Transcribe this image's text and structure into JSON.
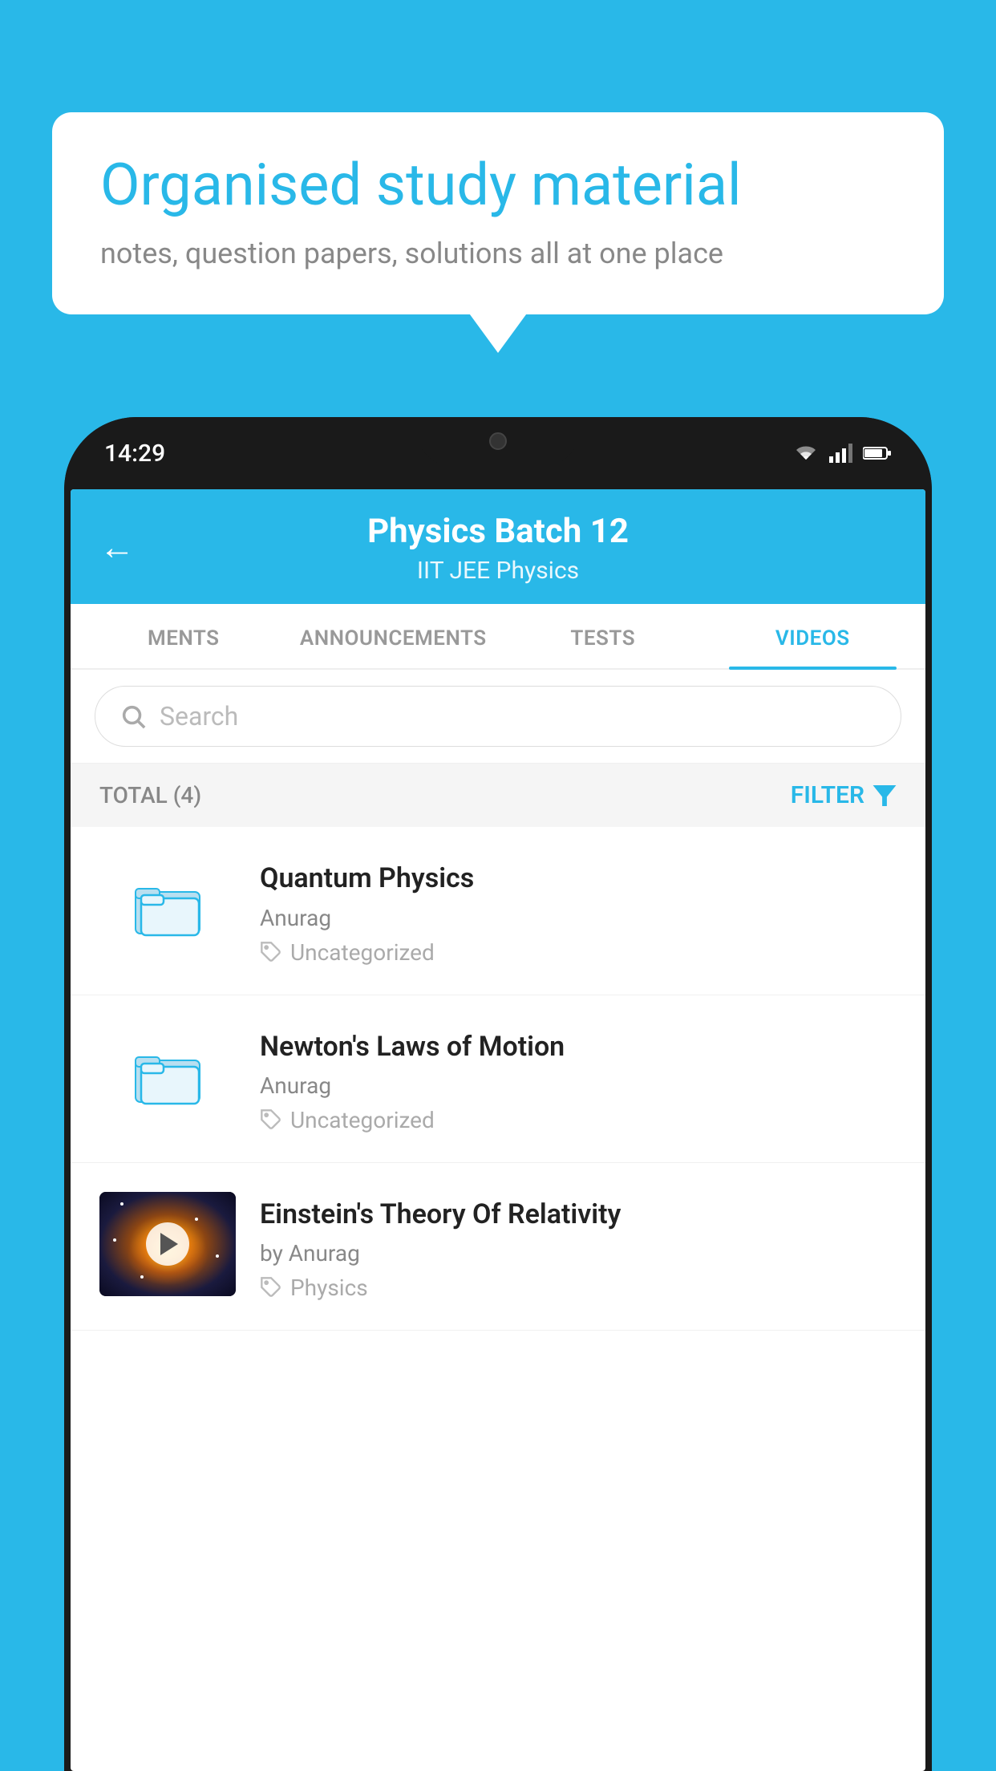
{
  "background_color": "#29b8e8",
  "speech_bubble": {
    "title": "Organised study material",
    "subtitle": "notes, question papers, solutions all at one place"
  },
  "phone": {
    "time": "14:29",
    "header": {
      "title": "Physics Batch 12",
      "subtitle": "IIT JEE   Physics",
      "back_label": "←"
    },
    "tabs": [
      {
        "label": "MENTS",
        "active": false
      },
      {
        "label": "ANNOUNCEMENTS",
        "active": false
      },
      {
        "label": "TESTS",
        "active": false
      },
      {
        "label": "VIDEOS",
        "active": true
      }
    ],
    "search": {
      "placeholder": "Search"
    },
    "filter_bar": {
      "total": "TOTAL (4)",
      "filter_label": "FILTER"
    },
    "videos": [
      {
        "title": "Quantum Physics",
        "author": "Anurag",
        "tag": "Uncategorized",
        "type": "folder"
      },
      {
        "title": "Newton's Laws of Motion",
        "author": "Anurag",
        "tag": "Uncategorized",
        "type": "folder"
      },
      {
        "title": "Einstein's Theory Of Relativity",
        "author": "by Anurag",
        "tag": "Physics",
        "type": "video"
      }
    ]
  }
}
